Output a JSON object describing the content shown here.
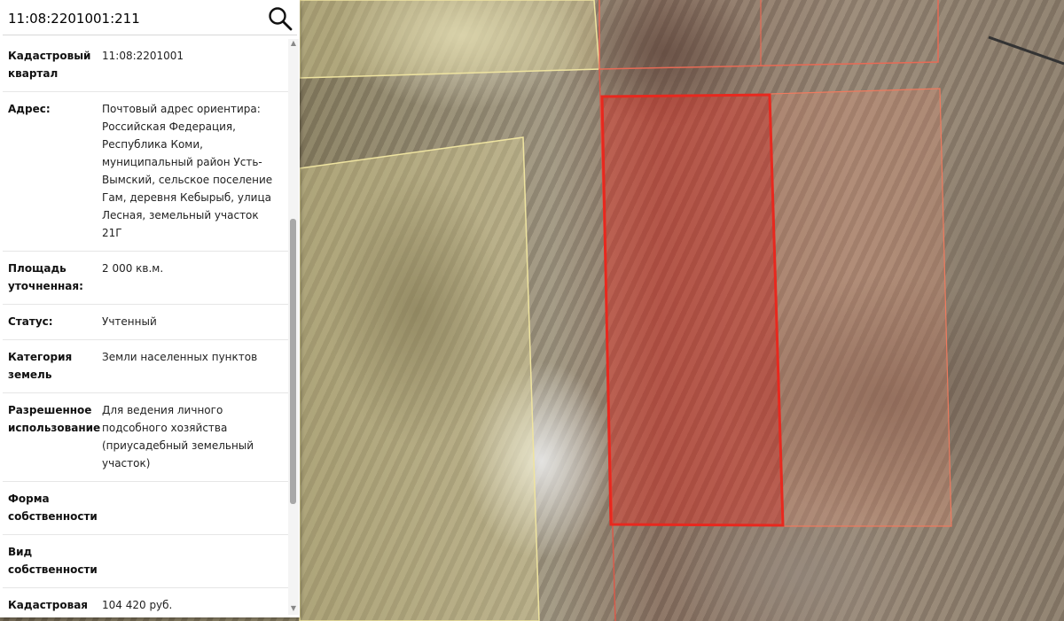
{
  "search": {
    "value": "11:08:2201001:211",
    "icon": "search-icon"
  },
  "info": [
    {
      "key": "Кадастровый квартал",
      "value": "11:08:2201001"
    },
    {
      "key": "Адрес:",
      "value": "Почтовый адрес ориентира: Российская Федерация, Республика Коми, муниципальный район Усть-Вымский, сельское поселение Гам, деревня Кебырыб, улица Лесная, земельный участок 21Г"
    },
    {
      "key": "Площадь уточненная:",
      "value": "2 000 кв.м."
    },
    {
      "key": "Статус:",
      "value": "Учтенный"
    },
    {
      "key": "Категория земель",
      "value": "Земли населенных пунктов"
    },
    {
      "key": "Разрешенное использование",
      "value": "Для ведения личного подсобного хозяйства (приусадебный земельный участок)"
    },
    {
      "key": "Форма собственности",
      "value": ""
    },
    {
      "key": "Вид собственности",
      "value": ""
    },
    {
      "key": "Кадастровая стоимость",
      "value": "104 420 руб."
    }
  ],
  "map": {
    "selected_parcel_color": "#e8281e",
    "neighbor_parcel_color": "#f07a5a",
    "quarter_boundary_color": "#f2e6a0"
  }
}
